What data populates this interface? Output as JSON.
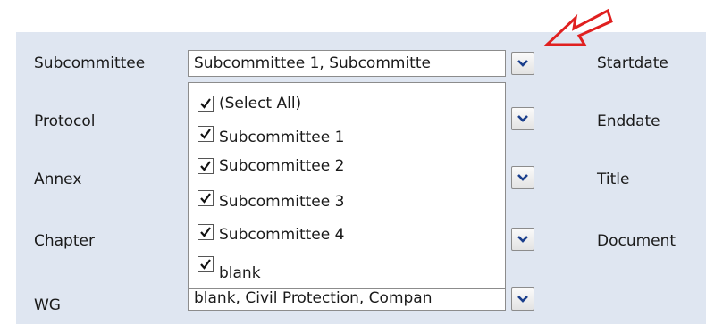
{
  "filters": {
    "subcommittee": {
      "label": "Subcommittee",
      "value": "Subcommittee 1, Subcommitte"
    },
    "protocol": {
      "label": "Protocol"
    },
    "annex": {
      "label": "Annex"
    },
    "chapter": {
      "label": "Chapter"
    },
    "wg": {
      "label": "WG",
      "value": "blank, Civil Protection, Compan"
    }
  },
  "right_labels": {
    "startdate": "Startdate",
    "enddate": "Enddate",
    "title": "Title",
    "document": "Document"
  },
  "dropdown": {
    "options": [
      {
        "label": "(Select All)",
        "checked": true
      },
      {
        "label": "Subcommittee 1",
        "checked": true
      },
      {
        "label": "Subcommittee 2",
        "checked": true
      },
      {
        "label": "Subcommittee 3",
        "checked": true
      },
      {
        "label": "Subcommittee 4",
        "checked": true
      },
      {
        "label": "blank",
        "checked": true
      }
    ]
  },
  "colors": {
    "panel_bg": "#dfe6f1",
    "arrow": "#e02020"
  }
}
